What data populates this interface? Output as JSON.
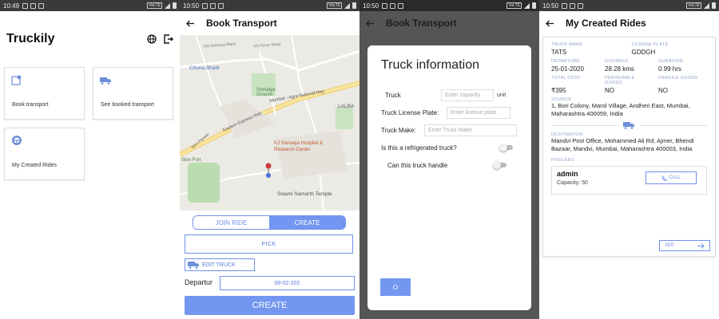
{
  "statusbar": [
    {
      "time": "10:49",
      "lte": "VoLTE"
    },
    {
      "time": "10:50",
      "lte": "VoLTE"
    },
    {
      "time": "10:50",
      "lte": "VoLTE"
    },
    {
      "time": "10:50",
      "lte": "VoLTE"
    }
  ],
  "home": {
    "title": "Truckily",
    "actions": [
      "globe-icon",
      "logout-icon"
    ],
    "tiles": [
      {
        "label": "Book transport",
        "icon": "map-pin-icon"
      },
      {
        "label": "See booked transport",
        "icon": "truck-icon"
      },
      {
        "label": "My Created Rides",
        "icon": "steering-wheel-icon"
      }
    ]
  },
  "book": {
    "title": "Book Transport",
    "map_labels": {
      "chuna_bhatti": "Chuna Bhatti",
      "somaiya_ground": "Somaiya Ground",
      "kj_somaiya": "KJ Somaiya Hospital & Research Center",
      "swami": "Swami Samarth Temple",
      "mumbai_agra": "Mumbai - Agra National Hwy",
      "eastern_expr": "Eastern Express Hwy",
      "sion_flyover": "Sion Flyover",
      "sion_fort": "Sion Fort",
      "lalbag": "LALBA",
      "ng_acharya": "NG Acharya Marg",
      "vn_purav": "VN Purav Marg"
    },
    "tab_join": "JOIN RIDE",
    "tab_create": "CREATE",
    "pick_label": "PICK",
    "edit_truck_label": "EDIT TRUCK",
    "departure_label": "Departur",
    "departure_value": "08-02-202",
    "create_label": "CREATE"
  },
  "truck_dialog": {
    "bg_title": "Book Transport",
    "title": "Truck information",
    "capacity_label": "Truck",
    "capacity_placeholder": "Enter capacity",
    "capacity_unit": "unit",
    "plate_label": "Truck License Plate:",
    "plate_placeholder": "Enter license plate",
    "make_label": "Truck Make:",
    "make_placeholder": "Enter Truck Make",
    "refrigerated_label": "Is this a refrigerated truck?",
    "handle_label": "Can this truck handle",
    "ok_label": "O"
  },
  "rides": {
    "title": "My Created Rides",
    "truck_make_label": "TRUCK MAKE",
    "truck_make": "TATS",
    "plate_label": "LICENSE PLATE",
    "plate": "GDDGH",
    "departure_label": "DEPARTURE",
    "departure": "25-01-2020",
    "distance_label": "DISTANCE",
    "distance": "28.28 kms",
    "duration_label": "DURATION",
    "duration": "0.99 hrs",
    "cost_label": "TOTAL COST",
    "cost": "₹395",
    "perishable_label": "PERISHABLE GOODS",
    "perishable": "NO",
    "fragile_label": "FRAGILE GOODS",
    "fragile": "NO",
    "source_label": "SOURCE",
    "source": "1, Bori Colony, Marol Village, Andheri East, Mumbai, Maharashtra 400059, India",
    "destination_label": "DESTINATION",
    "destination": "Mandvi Post Office, Mohammed Ali Rd, Ajmer, Bhendi Bazaar, Mandvi, Mumbai, Maharashtra 400003, India",
    "poolers_label": "POOLERS",
    "pooler_name": "admin",
    "pooler_capacity": "Capacity: 50",
    "call_label": "CALL",
    "see_label": "SEE"
  },
  "colors": {
    "accent": "#7396f0",
    "accent_dark": "#5a7ad8"
  }
}
